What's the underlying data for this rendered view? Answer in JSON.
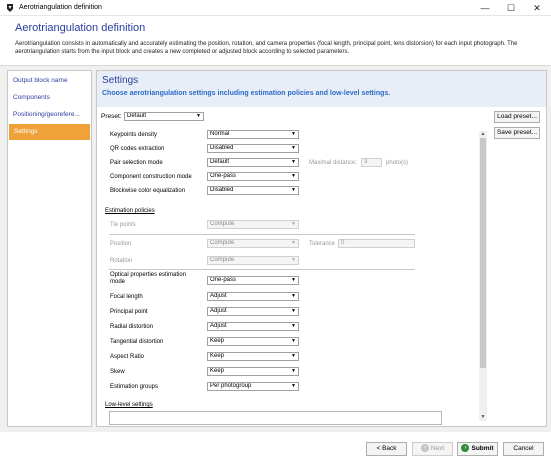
{
  "window": {
    "title": "Aerotriangulation definition",
    "minimize_glyph": "—",
    "maximize_glyph": "☐",
    "close_glyph": "✕"
  },
  "header": {
    "title": "Aerotriangulation definition",
    "description": "Aerotriangulation consists in automatically and accurately estimating the position, rotation, and camera properties (focal length, principal point, lens distorsion) for each input photograph. The aerotriangulation starts from the input block and creates a new completed or adjusted block according to selected parameters."
  },
  "sidebar": {
    "items": [
      {
        "label": "Output block name"
      },
      {
        "label": "Components"
      },
      {
        "label": "Positioning/georefere..."
      },
      {
        "label": "Settings"
      }
    ]
  },
  "settings": {
    "title": "Settings",
    "subtitle": "Choose aerotriangulation settings including estimation policies and low-level settings.",
    "preset_label": "Preset:",
    "preset_value": "Default",
    "load_preset": "Load preset...",
    "save_preset": "Save preset...",
    "rows": [
      {
        "label": "Keypoints density",
        "value": "Normal"
      },
      {
        "label": "QR codes extraction",
        "value": "Disabled"
      },
      {
        "label": "Pair selection mode",
        "value": "Default"
      },
      {
        "label": "Component construction mode",
        "value": "One-pass"
      },
      {
        "label": "Blockwise color equalization",
        "value": "Disabled"
      }
    ],
    "maximal_distance_label": "Maximal distance:",
    "maximal_distance_value": "3",
    "maximal_distance_unit": "photo(s)",
    "estimation_policies_label": "Estimation policies",
    "policy_rows": [
      {
        "label": "Tie points",
        "value": "Compute"
      },
      {
        "label": "Position",
        "value": "Compute"
      },
      {
        "label": "Rotation",
        "value": "Compute"
      }
    ],
    "tolerance_label": "Tolerance",
    "tolerance_value": "0",
    "optical_rows": [
      {
        "label": "Optical properties estimation mode",
        "value": "One-pass"
      },
      {
        "label": "Focal length",
        "value": "Adjust"
      },
      {
        "label": "Principal point",
        "value": "Adjust"
      },
      {
        "label": "Radial distortion",
        "value": "Adjust"
      },
      {
        "label": "Tangential distortion",
        "value": "Keep"
      },
      {
        "label": "Aspect Ratio",
        "value": "Keep"
      },
      {
        "label": "Skew",
        "value": "Keep"
      },
      {
        "label": "Estimation groups",
        "value": "Per photogroup"
      }
    ],
    "low_level_label": "Low-level settings"
  },
  "footer": {
    "back": "< Back",
    "next": "Next",
    "submit": "Submit",
    "cancel": "Cancel"
  },
  "colors": {
    "accent": "#2c3e9e",
    "active_tab": "#f0a23a",
    "submit_green": "#2e8b3c"
  }
}
